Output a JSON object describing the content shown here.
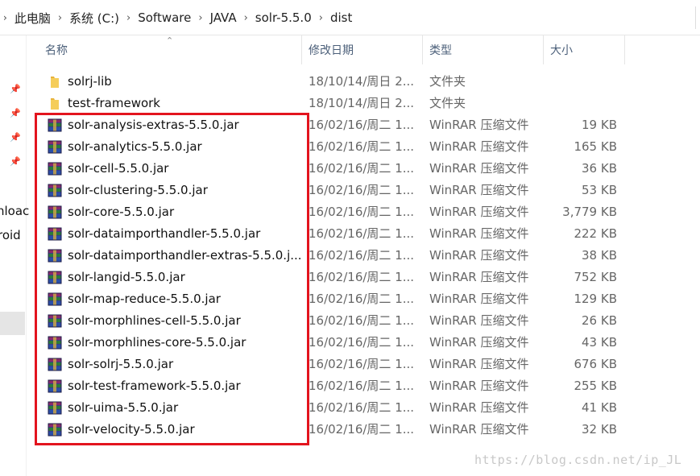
{
  "breadcrumb": {
    "items": [
      "此电脑",
      "系统 (C:)",
      "Software",
      "JAVA",
      "solr-5.5.0",
      "dist"
    ],
    "separator": "›",
    "lead_arrow": "›"
  },
  "sidebar": {
    "partial_labels": [
      "nloac",
      "roid"
    ]
  },
  "columns": {
    "name": "名称",
    "modified": "修改日期",
    "type": "类型",
    "size": "大小"
  },
  "files": [
    {
      "name": "solrj-lib",
      "date": "18/10/14/周日 2...",
      "type": "文件夹",
      "size": "",
      "icon": "folder-icon"
    },
    {
      "name": "test-framework",
      "date": "18/10/14/周日 2...",
      "type": "文件夹",
      "size": "",
      "icon": "folder-icon"
    },
    {
      "name": "solr-analysis-extras-5.5.0.jar",
      "date": "16/02/16/周二 1...",
      "type": "WinRAR 压缩文件",
      "size": "19 KB",
      "icon": "winrar-archive-icon"
    },
    {
      "name": "solr-analytics-5.5.0.jar",
      "date": "16/02/16/周二 1...",
      "type": "WinRAR 压缩文件",
      "size": "165 KB",
      "icon": "winrar-archive-icon"
    },
    {
      "name": "solr-cell-5.5.0.jar",
      "date": "16/02/16/周二 1...",
      "type": "WinRAR 压缩文件",
      "size": "36 KB",
      "icon": "winrar-archive-icon"
    },
    {
      "name": "solr-clustering-5.5.0.jar",
      "date": "16/02/16/周二 1...",
      "type": "WinRAR 压缩文件",
      "size": "53 KB",
      "icon": "winrar-archive-icon"
    },
    {
      "name": "solr-core-5.5.0.jar",
      "date": "16/02/16/周二 1...",
      "type": "WinRAR 压缩文件",
      "size": "3,779 KB",
      "icon": "winrar-archive-icon"
    },
    {
      "name": "solr-dataimporthandler-5.5.0.jar",
      "date": "16/02/16/周二 1...",
      "type": "WinRAR 压缩文件",
      "size": "222 KB",
      "icon": "winrar-archive-icon"
    },
    {
      "name": "solr-dataimporthandler-extras-5.5.0.j...",
      "date": "16/02/16/周二 1...",
      "type": "WinRAR 压缩文件",
      "size": "38 KB",
      "icon": "winrar-archive-icon"
    },
    {
      "name": "solr-langid-5.5.0.jar",
      "date": "16/02/16/周二 1...",
      "type": "WinRAR 压缩文件",
      "size": "752 KB",
      "icon": "winrar-archive-icon"
    },
    {
      "name": "solr-map-reduce-5.5.0.jar",
      "date": "16/02/16/周二 1...",
      "type": "WinRAR 压缩文件",
      "size": "129 KB",
      "icon": "winrar-archive-icon"
    },
    {
      "name": "solr-morphlines-cell-5.5.0.jar",
      "date": "16/02/16/周二 1...",
      "type": "WinRAR 压缩文件",
      "size": "26 KB",
      "icon": "winrar-archive-icon"
    },
    {
      "name": "solr-morphlines-core-5.5.0.jar",
      "date": "16/02/16/周二 1...",
      "type": "WinRAR 压缩文件",
      "size": "43 KB",
      "icon": "winrar-archive-icon"
    },
    {
      "name": "solr-solrj-5.5.0.jar",
      "date": "16/02/16/周二 1...",
      "type": "WinRAR 压缩文件",
      "size": "676 KB",
      "icon": "winrar-archive-icon"
    },
    {
      "name": "solr-test-framework-5.5.0.jar",
      "date": "16/02/16/周二 1...",
      "type": "WinRAR 压缩文件",
      "size": "255 KB",
      "icon": "winrar-archive-icon"
    },
    {
      "name": "solr-uima-5.5.0.jar",
      "date": "16/02/16/周二 1...",
      "type": "WinRAR 压缩文件",
      "size": "41 KB",
      "icon": "winrar-archive-icon"
    },
    {
      "name": "solr-velocity-5.5.0.jar",
      "date": "16/02/16/周二 1...",
      "type": "WinRAR 压缩文件",
      "size": "32 KB",
      "icon": "winrar-archive-icon"
    }
  ],
  "watermark": "https://blog.csdn.net/ip_JL",
  "colors": {
    "highlight_box": "#e3141e",
    "header_text": "#4c607a",
    "folder": "#f2c24b"
  }
}
